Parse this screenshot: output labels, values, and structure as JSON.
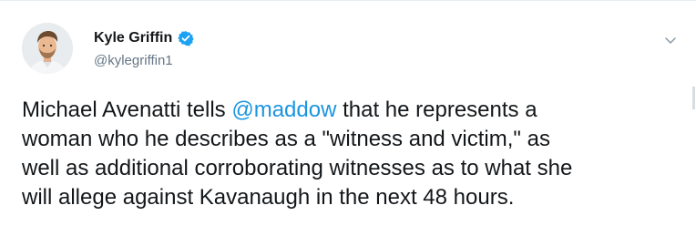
{
  "tweet": {
    "author": {
      "display_name": "Kyle Griffin",
      "handle": "@kylegriffin1",
      "verified": true,
      "avatar_icon": "profile-photo"
    },
    "menu_icon": "chevron-down-icon",
    "text_lines": [
      {
        "before": "Michael Avenatti tells ",
        "mention": "@maddow",
        "after": " that he represents a"
      },
      {
        "before": "woman who he describes as a \"witness and victim,\" as"
      },
      {
        "before": "well as additional corroborating witnesses as to what she"
      },
      {
        "before": "will allege against Kavanaugh in the next 48 hours."
      }
    ]
  },
  "colors": {
    "text": "#14171a",
    "secondary": "#657786",
    "link": "#1b95e0",
    "verified": "#1da1f2"
  }
}
